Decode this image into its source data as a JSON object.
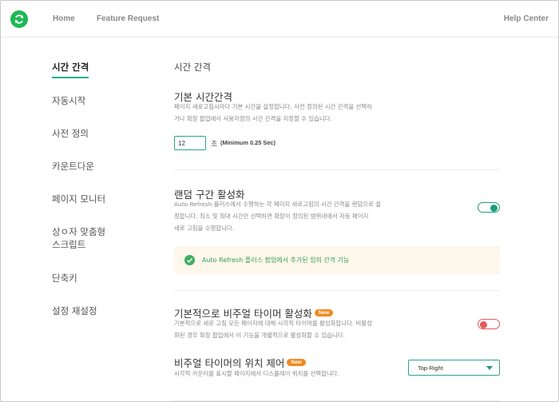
{
  "header": {
    "nav": {
      "home": "Home",
      "feature_request": "Feature Request",
      "help_center": "Help Center"
    },
    "logo_icon": "refresh-arrows-icon",
    "brand_color": "#1db954"
  },
  "sidebar": {
    "items": [
      {
        "label": "시간 간격",
        "active": true
      },
      {
        "label": "자동시작"
      },
      {
        "label": "사전 정의"
      },
      {
        "label": "카운트다운"
      },
      {
        "label": "페이지 모니터"
      },
      {
        "label_line1": "상ㅇ자 맞춤형",
        "label_line2": "스크립트"
      },
      {
        "label": "단축키"
      },
      {
        "label": "설정 재설정"
      }
    ],
    "active_color": "#27ae8f"
  },
  "main": {
    "heading": "시간 간격",
    "default_interval": {
      "title": "기본 시간간격",
      "desc_line1": "페이지 새로고침시마다 기본 시간을 설정합니다. 사전 정의된 시간 간격을 선택하",
      "desc_line2": "거나 확장 팝업에서 사용자정의 시간 간격을 지정할 수 있습니다.",
      "value": "12",
      "unit": "초",
      "note": "(Minimum 0.25 Sec)"
    },
    "random_range": {
      "title": "랜덤 구간 활성화",
      "desc_line1": "Auto Refresh 플러스에서 수행하는 각 페이지 새로고침의 시간 간격을 랜덤으로 설",
      "desc_line2": "정합니다. 최소 및 최대 시간만 선택하면 확장이 정의된 범위내에서 자동 페이지",
      "desc_line3": "새로 고침을 수행합니다.",
      "enabled": true,
      "info_text": "Auto Refresh 플러스 팝업에서 추가된 임의 간격 기능"
    },
    "visual_timer": {
      "title": "기본적으로 비주얼 타이머 활성화",
      "badge": "New",
      "desc_line1": "기본적으로 새로 고침 모든 페이지에 대해 시각적 타이머를 활성화합니다. 비활성",
      "desc_line2": "화된 경우 확장 팝업에서 이 기능을 개별적으로 활성화할 수 있습니다.",
      "enabled": false
    },
    "timer_position": {
      "title": "비주얼 타이머의 위치 제어",
      "badge": "New",
      "desc_line1": "시각적 카운터를 표시할 페이지에서 디스플레이 위치를 선택합니다.",
      "selected": "Top-Right"
    }
  },
  "colors": {
    "toggle_on": "#1e9e7e",
    "toggle_off": "#e25a5a",
    "badge": "#f18a21",
    "info_bg": "#fdf7ec",
    "info_text": "#3f9d57"
  }
}
